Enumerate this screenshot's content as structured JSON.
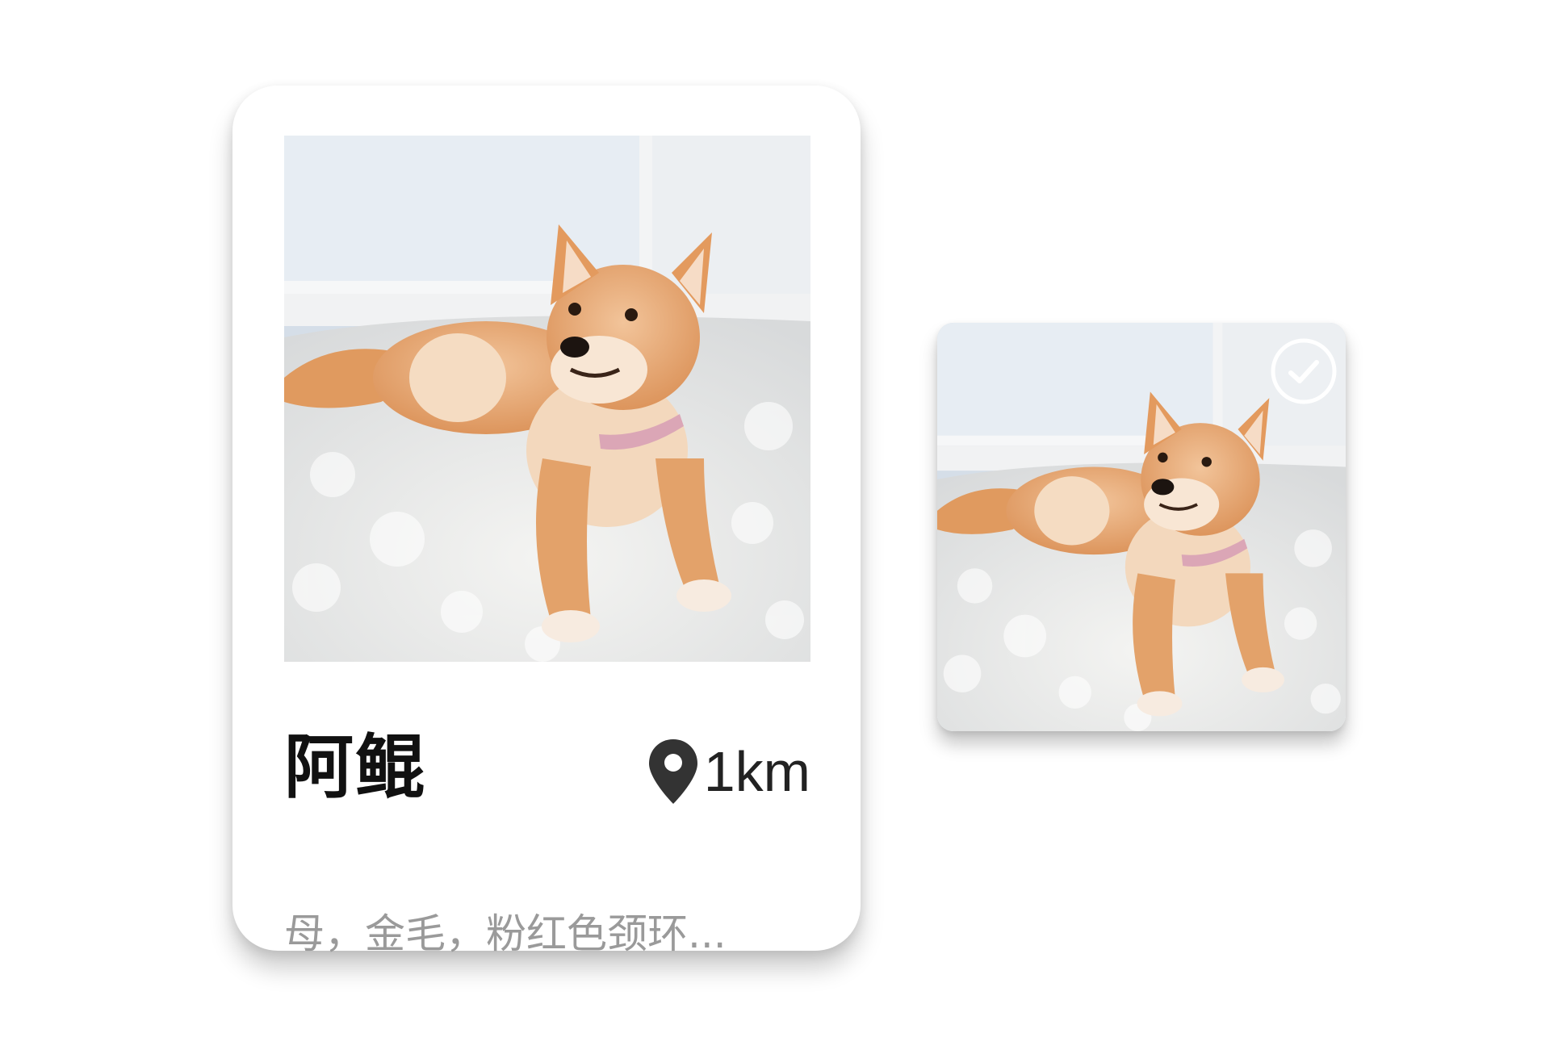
{
  "card": {
    "name": "阿鲲",
    "distance": "1km",
    "description": "母，金毛，粉红色颈环...",
    "photo_icon": "shiba-puppy-photo",
    "location_icon": "map-pin-icon"
  },
  "thumbnail": {
    "photo_icon": "shiba-puppy-photo",
    "status_icon": "check-circle-icon"
  },
  "colors": {
    "card_bg": "#ffffff",
    "name_text": "#111111",
    "desc_text": "#9a9a9a",
    "pin": "#333333"
  }
}
